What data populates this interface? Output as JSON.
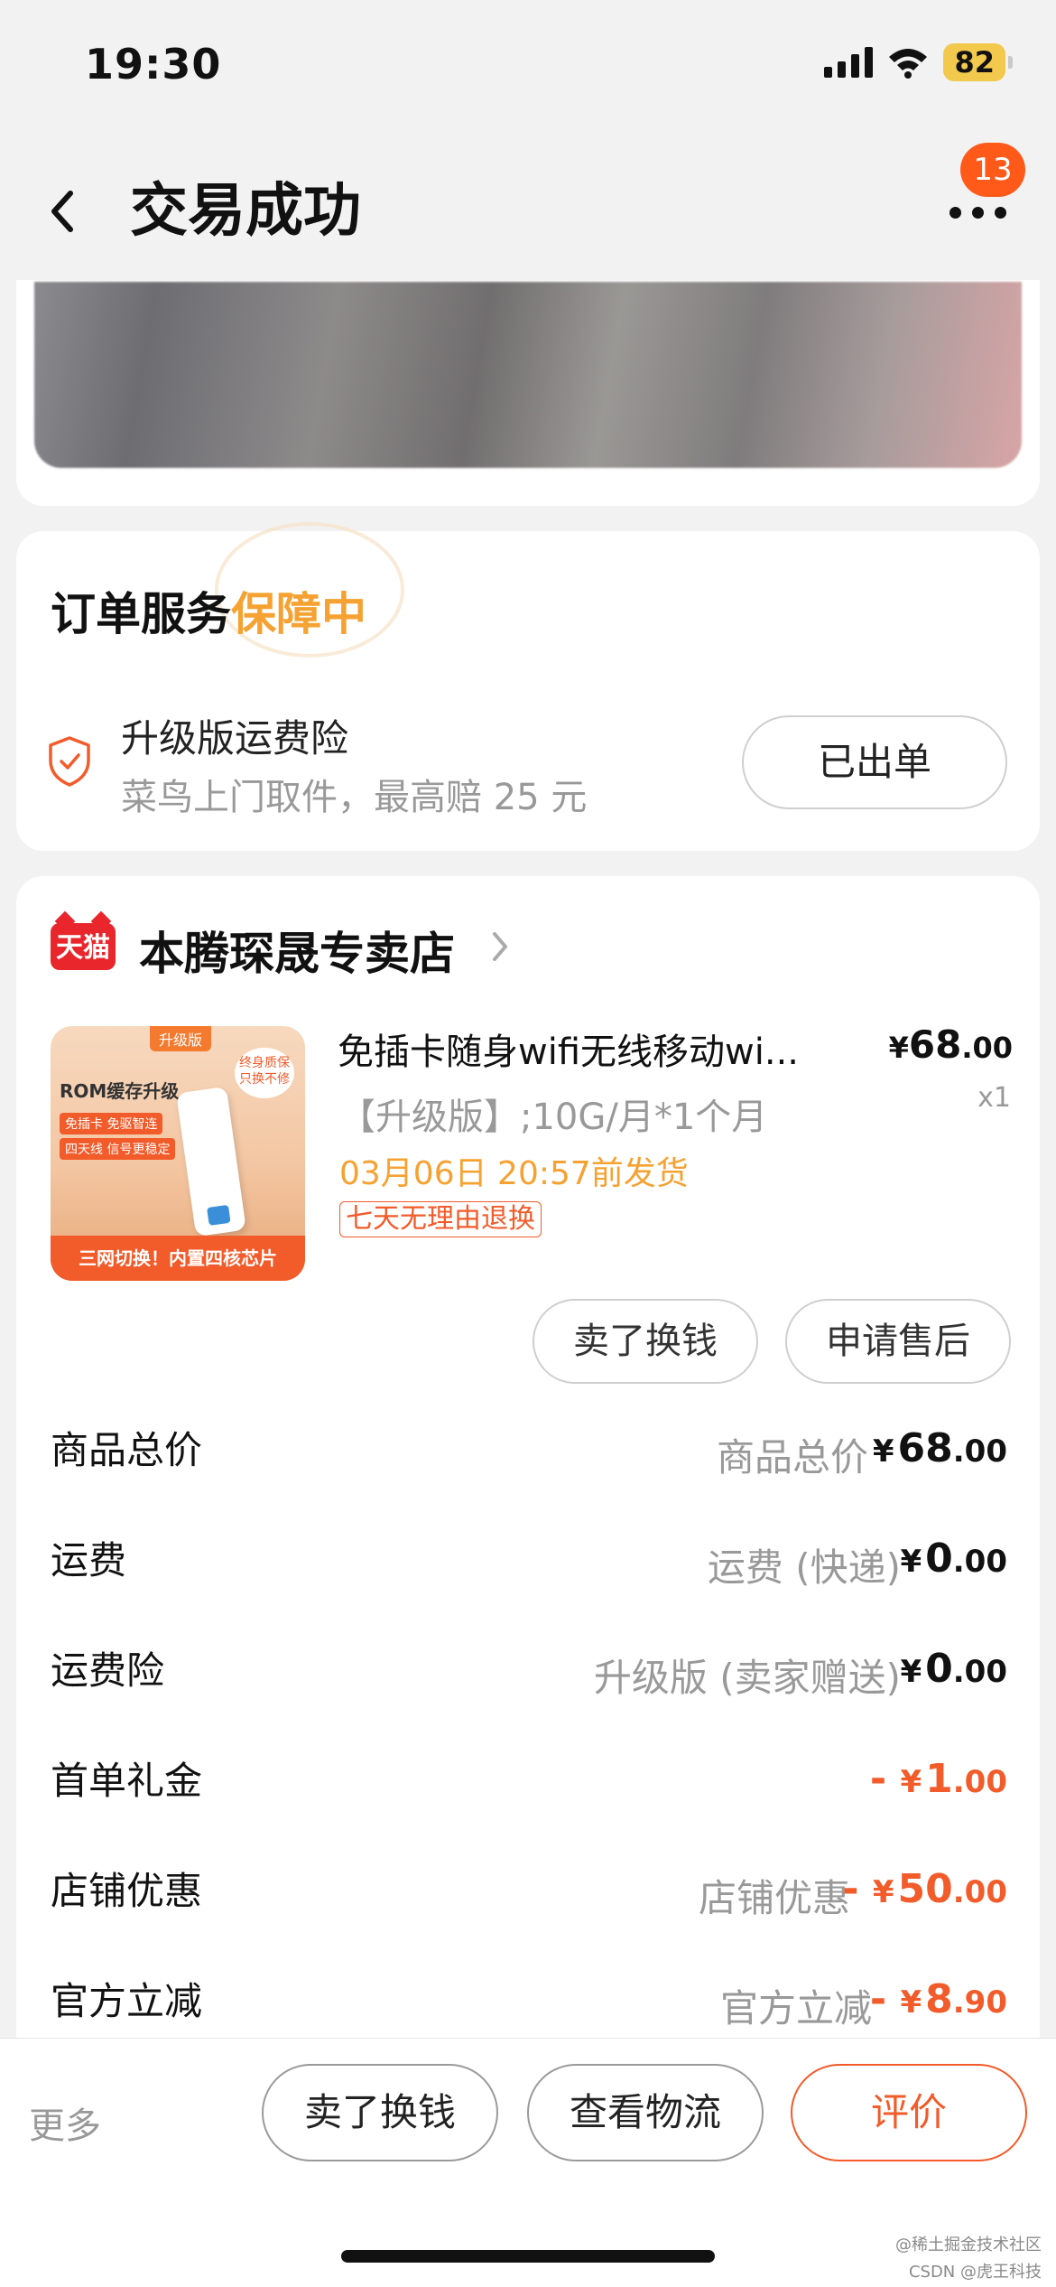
{
  "status_bar": {
    "time": "19:30",
    "battery": "82"
  },
  "nav": {
    "title": "交易成功",
    "more_badge": "13"
  },
  "service": {
    "title_prefix": "订单服务",
    "title_highlight": "保障中",
    "insurance_name": "升级版运费险",
    "insurance_desc": "菜鸟上门取件，最高赔 25 元",
    "issued_button": "已出单"
  },
  "store": {
    "badge": "天猫",
    "name": "本腾琛晟专卖店"
  },
  "product": {
    "image": {
      "tag": "升级版",
      "title": "ROM缓存升级",
      "chips": [
        "免插卡 免驱智连",
        "四天线 信号更稳定"
      ],
      "bubble": "终身质保 只换不修",
      "banner": "三网切换！内置四核芯片"
    },
    "title": "免插卡随身wifi无线移动wi...",
    "price_yen": "¥",
    "price_int": "68",
    "price_dec": ".00",
    "qty": "x1",
    "sku": "【升级版】;10G/月*1个月",
    "ship": "03月06日 20:57前发货",
    "return_tag": "七天无理由退换",
    "btn_sell": "卖了换钱",
    "btn_aftersale": "申请售后"
  },
  "price_rows": [
    {
      "label": "商品总价",
      "sub": "商品总价",
      "sign": "",
      "yen": "¥",
      "int": "68",
      "dec": ".00"
    },
    {
      "label": "运费",
      "sub": "运费 (快递)",
      "sign": "",
      "yen": "¥",
      "int": "0",
      "dec": ".00"
    },
    {
      "label": "运费险",
      "sub": "升级版 (卖家赠送)",
      "sign": "",
      "yen": "¥",
      "int": "0",
      "dec": ".00"
    },
    {
      "label": "首单礼金",
      "sub": "",
      "sign": "- ",
      "yen": "¥",
      "int": "1",
      "dec": ".00"
    },
    {
      "label": "店铺优惠",
      "sub": "店铺优惠",
      "sign": "- ",
      "yen": "¥",
      "int": "50",
      "dec": ".00"
    },
    {
      "label": "官方立减",
      "sub": "官方立减",
      "sign": "- ",
      "yen": "¥",
      "int": "8",
      "dec": ".90"
    }
  ],
  "bottom_bar": {
    "more": "更多",
    "btn_sell": "卖了换钱",
    "btn_logistics": "查看物流",
    "btn_review": "评价"
  },
  "watermarks": [
    "@稀土掘金技术社区",
    "CSDN @虎王科技"
  ],
  "colors": {
    "accent": "#f25b2a",
    "highlight": "#f5a232",
    "tmall": "#e8262c"
  }
}
